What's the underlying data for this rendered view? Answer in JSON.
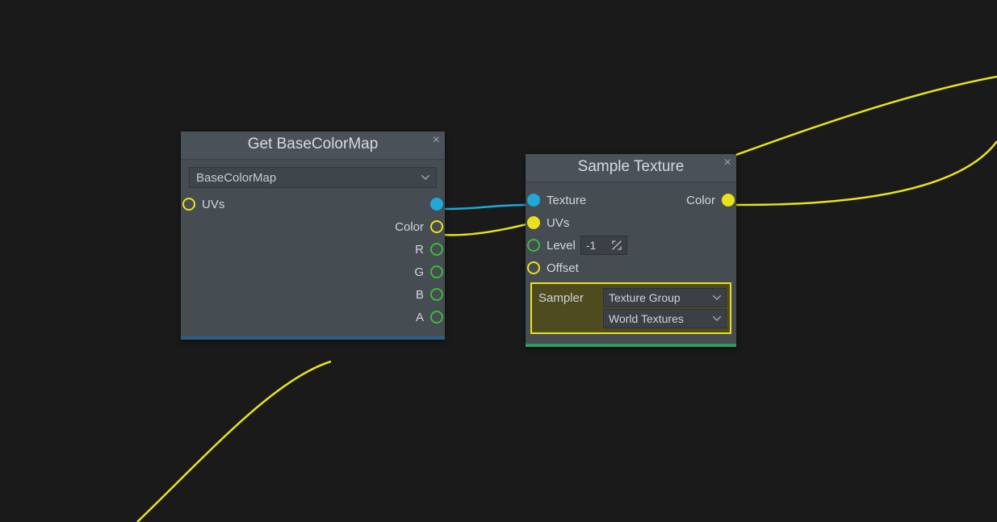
{
  "node1": {
    "title": "Get BaseColorMap",
    "param_name": "BaseColorMap",
    "inputs": {
      "uvs": "UVs"
    },
    "outputs": {
      "texture": "",
      "color": "Color",
      "r": "R",
      "g": "G",
      "b": "B",
      "a": "A"
    }
  },
  "node2": {
    "title": "Sample Texture",
    "inputs": {
      "texture": "Texture",
      "uvs": "UVs",
      "level": "Level",
      "offset": "Offset"
    },
    "outputs": {
      "color": "Color"
    },
    "level_value": "-1",
    "sampler": {
      "label": "Sampler",
      "select1": "Texture Group",
      "select2": "World Textures"
    }
  },
  "colors": {
    "wire_yellow": "#e9e21a",
    "wire_cyan": "#1fa8d8"
  }
}
